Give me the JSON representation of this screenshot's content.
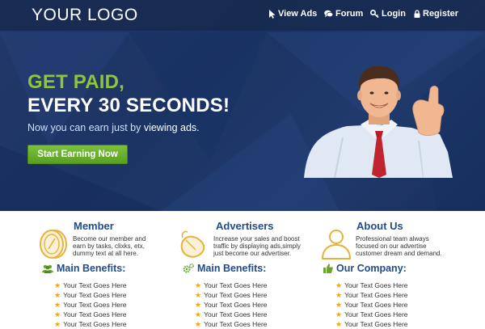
{
  "brand": {
    "logo_text": "YOUR LOGO"
  },
  "nav": [
    {
      "label": "View Ads",
      "icon": "cursor-icon"
    },
    {
      "label": "Forum",
      "icon": "chat-icon"
    },
    {
      "label": "Login",
      "icon": "key-icon"
    },
    {
      "label": "Register",
      "icon": "lock-icon"
    }
  ],
  "hero": {
    "headline_1": "GET PAID,",
    "headline_2": "EVERY 30 SECONDS!",
    "subline_pre": "Now you can earn just by ",
    "subline_emph": "viewing ads.",
    "cta_label": "Start Earning Now"
  },
  "columns": [
    {
      "title": "Member",
      "icon": "coin-icon",
      "description": [
        "Become our member and",
        "earn by tasks, clixks, etx,",
        "dummy text at all here."
      ],
      "benefits_title": "Main Benefits:",
      "benefits_icon": "people-icon",
      "bullets": [
        "Your Text Goes Here",
        "Your Text Goes Here",
        "Your Text Goes Here",
        "Your Text Goes Here",
        "Your Text Goes Here"
      ]
    },
    {
      "title": "Advertisers",
      "icon": "mouse-icon",
      "description": [
        "Increase your sales and boost",
        "traffic by displaying ads,simply",
        "just become our advertiser."
      ],
      "benefits_title": "Main Benefits:",
      "benefits_icon": "gears-icon",
      "bullets": [
        "Your Text Goes Here",
        "Your Text Goes Here",
        "Your Text Goes Here",
        "Your Text Goes Here",
        "Your Text Goes Here"
      ]
    },
    {
      "title": "About Us",
      "icon": "person-outline-icon",
      "description": [
        "Professional team always",
        "focused on our advertise",
        "customer dream and demand."
      ],
      "benefits_title": "Our Company:",
      "benefits_icon": "thumbs-up-icon",
      "bullets": [
        "Your Text Goes Here",
        "Your Text Goes Here",
        "Your Text Goes Here",
        "Your Text Goes Here",
        "Your Text Goes Here"
      ]
    }
  ],
  "colors": {
    "hero_bg": "#1f3766",
    "accent_green": "#8fc43c",
    "button_green": "#6bb22f",
    "heading_blue": "#1f4c8c",
    "star_orange": "#f2a31b"
  }
}
